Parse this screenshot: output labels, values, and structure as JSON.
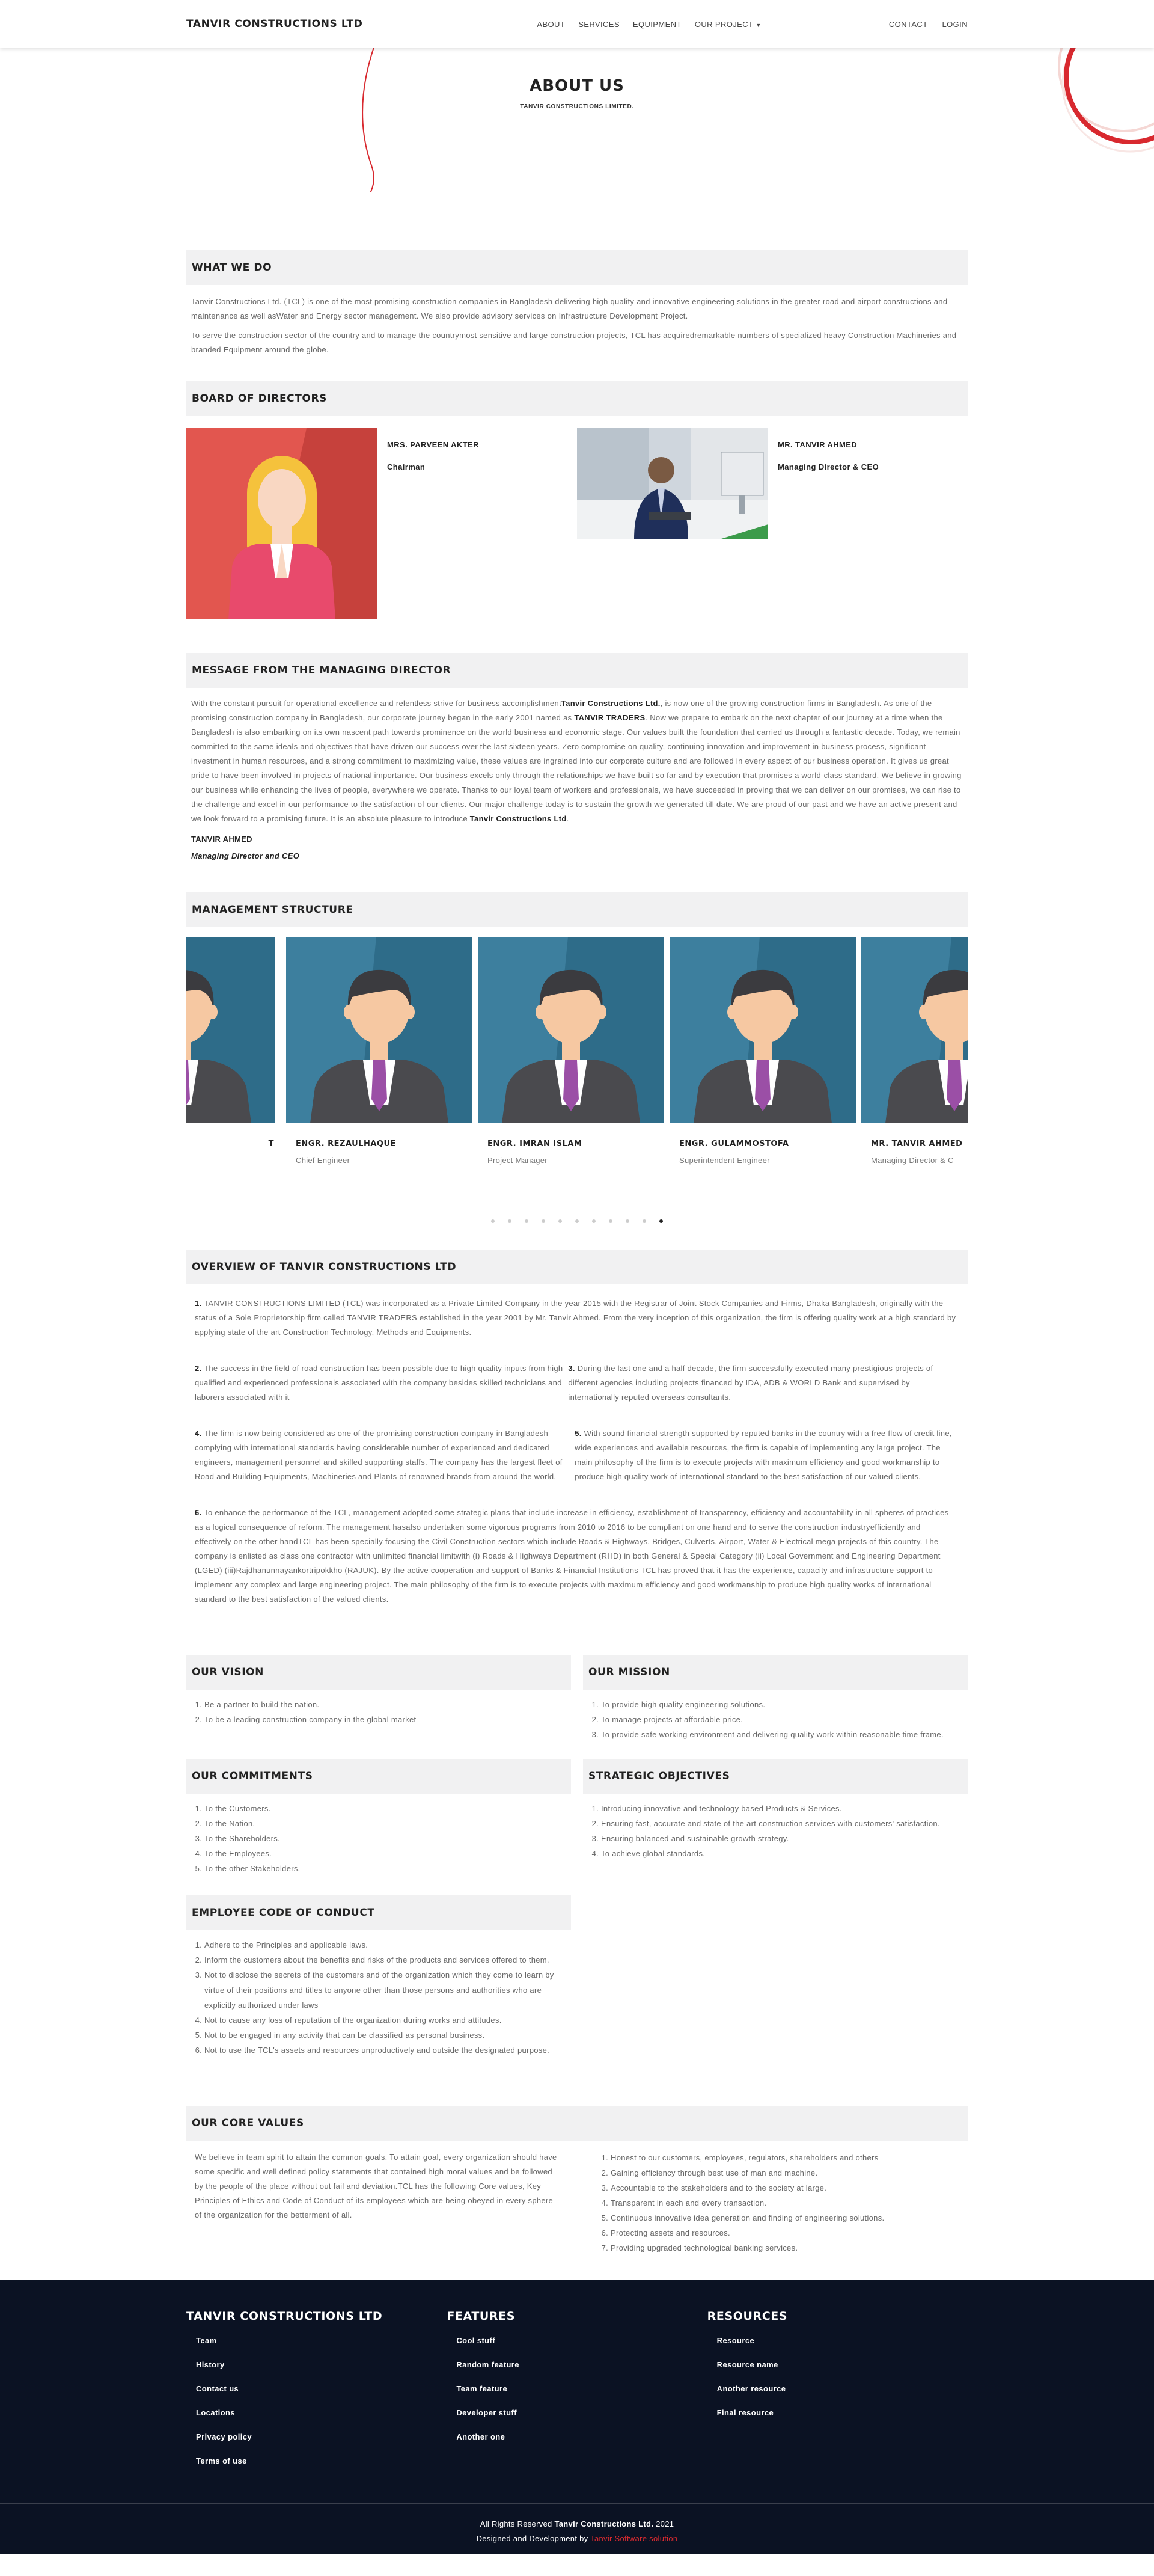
{
  "nav": {
    "brand": "TANVIR CONSTRUCTIONS LTD",
    "links": [
      "ABOUT",
      "SERVICES",
      "EQUIPMENT",
      "OUR PROJECT"
    ],
    "right": [
      "CONTACT",
      "LOGIN"
    ]
  },
  "hero": {
    "title": "ABOUT US",
    "subtitle": "TANVIR CONSTRUCTIONS LIMITED."
  },
  "what_we_do": {
    "heading": "WHAT WE DO",
    "p1": "Tanvir Constructions Ltd. (TCL) is one of the most promising construction companies in Bangladesh delivering high quality and innovative engineering solutions in the greater road and airport constructions and maintenance as well asWater and Energy sector management. We also provide advisory services on Infrastructure Development Project.",
    "p2": "To serve the construction sector of the country and to manage the countrymost sensitive and large construction projects, TCL has acquiredremarkable numbers of specialized heavy Construction Machineries and branded Equipment around the globe."
  },
  "board": {
    "heading": "BOARD OF DIRECTORS",
    "members": [
      {
        "name": "MRS. PARVEEN AKTER",
        "role": "Chairman"
      },
      {
        "name": "MR. TANVIR AHMED",
        "role": "Managing Director & CEO"
      }
    ]
  },
  "message": {
    "heading": "MESSAGE FROM THE MANAGING DIRECTOR",
    "a": "With the constant pursuit for operational excellence and relentless strive for business accomplishment",
    "b1": "Tanvir Constructions Ltd.",
    "c": ", is now one of the growing construction firms in Bangladesh. As one of the promising construction company in Bangladesh, our corporate journey began in the early 2001 named as",
    "b2": "TANVIR TRADERS",
    "d": ". Now we prepare to embark on the next chapter of our journey at a time when the Bangladesh is also embarking on its own nascent path towards prominence on the world business and economic stage. Our values built the foundation that carried us through a fantastic decade. Today, we remain committed to the same ideals and objectives that have driven our success over the last sixteen years. Zero compromise on quality, continuing innovation and improvement in business process, significant investment in human resources, and a strong commitment to maximizing value, these values are ingrained into our corporate culture and are followed in every aspect of our business operation. It gives us great pride to have been involved in projects of national importance. Our business excels only through the relationships we have built so far and by execution that promises a world-class standard. We believe in growing our business while enhancing the lives of people, everywhere we operate. Thanks to our loyal team of workers and professionals, we have succeeded in proving that we can deliver on our promises, we can rise to the challenge and excel in our performance to the satisfaction of our clients. Our major challenge today is to sustain the growth we generated till date. We are proud of our past and we have an active present and we look forward to a promising future. It is an absolute pleasure to introduce",
    "b3": "Tanvir Constructions Ltd",
    "e": ".",
    "sign_name": "TANVIR AHMED",
    "sign_role": "Managing Director and CEO"
  },
  "management": {
    "heading": "MANAGEMENT STRUCTURE",
    "partial_left_name": "T",
    "people": [
      {
        "name": "ENGR. REZAULHAQUE",
        "role": "Chief Engineer"
      },
      {
        "name": "ENGR. IMRAN ISLAM",
        "role": "Project Manager"
      },
      {
        "name": "ENGR. GULAMMOSTOFA",
        "role": "Superintendent Engineer"
      },
      {
        "name": "MR. TANVIR AHMED",
        "role": "Managing Director & C"
      }
    ],
    "dots": 11,
    "active_dot": 10
  },
  "overview": {
    "heading": "OVERVIEW OF TANVIR CONSTRUCTIONS LTD",
    "n1": "1.",
    "t1": "TANVIR CONSTRUCTIONS LIMITED (TCL) was incorporated as a Private Limited Company in the year 2015 with the Registrar of Joint Stock Companies and Firms, Dhaka Bangladesh, originally with the status of a Sole Proprietorship firm called TANVIR TRADERS established in the year 2001 by Mr. Tanvir Ahmed. From the very inception of this organization, the firm is offering quality work at a high standard by applying state of the art Construction Technology, Methods and Equipments.",
    "n2": "2.",
    "t2": "The success in the field of road construction has been possible due to high quality inputs from high qualified and experienced professionals associated with the company besides skilled technicians and laborers associated with it",
    "n3": "3.",
    "t3": "During the last one and a half decade, the firm successfully executed many prestigious projects of different agencies including projects financed by IDA, ADB & WORLD Bank and supervised by internationally reputed overseas consultants.",
    "n4": "4.",
    "t4": "The firm is now being considered as one of the promising construction company in Bangladesh complying with international standards having considerable number of experienced and dedicated engineers, management personnel and skilled supporting staffs. The company has the largest fleet of Road and Building Equipments, Machineries and Plants of renowned brands from around the world.",
    "n5": "5.",
    "t5": "With sound financial strength supported by reputed banks in the country with a free flow of credit line, wide experiences and available resources, the firm is capable of implementing any large project. The main philosophy of the firm is to execute projects with maximum efficiency and good workmanship to produce high quality work of international standard to the best satisfaction of our valued clients.",
    "n6": "6.",
    "t6": "To enhance the performance of the TCL, management adopted some strategic plans that include increase in efficiency, establishment of transparency, efficiency and accountability in all spheres of practices as a logical consequence of reform. The management hasalso undertaken some vigorous programs from 2010 to 2016 to be compliant on one hand and to serve the construction industryefficiently and effectively on the other handTCL has been specially focusing the Civil Construction sectors which include Roads & Highways, Bridges, Culverts, Airport, Water & Electrical mega projects of this country. The company is enlisted as class one contractor with unlimited financial limitwith (i) Roads & Highways Department (RHD) in both General & Special Category (ii) Local Government and Engineering Department (LGED) (iii)Rajdhanunnayankortripokkho (RAJUK). By the active cooperation and support of Banks & Financial Institutions TCL has proved that it has the experience, capacity and infrastructure support to implement any complex and large engineering project. The main philosophy of the firm is to execute projects with maximum efficiency and good workmanship to produce high quality works of international standard to the best satisfaction of the valued clients."
  },
  "vision": {
    "heading": "OUR VISION",
    "items": [
      "Be a partner to build the nation.",
      "To be a leading construction company in the global market"
    ]
  },
  "mission": {
    "heading": "OUR MISSION",
    "items": [
      "To provide high quality engineering solutions.",
      "To manage projects at affordable price.",
      "To provide safe working environment and delivering quality work within reasonable time frame."
    ]
  },
  "commitments": {
    "heading": "OUR COMMITMENTS",
    "items": [
      "To the Customers.",
      "To the Nation.",
      "To the Shareholders.",
      "To the Employees.",
      "To the other Stakeholders."
    ]
  },
  "strategic": {
    "heading": "STRATEGIC OBJECTIVES",
    "items": [
      "Introducing innovative and technology based Products & Services.",
      "Ensuring fast, accurate and state of the art construction services with customers' satisfaction.",
      "Ensuring balanced and sustainable growth strategy.",
      "To achieve global standards."
    ]
  },
  "conduct": {
    "heading": "EMPLOYEE CODE OF CONDUCT",
    "items": [
      "Adhere to the Principles and applicable laws.",
      "Inform the customers about the benefits and risks of the products and services offered to them.",
      "Not to disclose the secrets of the customers and of the organization which they come to learn by virtue of their positions and titles to anyone other than those persons and authorities who are explicitly authorized under laws",
      "Not to cause any loss of reputation of the organization during works and attitudes.",
      "Not to be engaged in any activity that can be classified as personal business.",
      "Not to use the TCL's assets and resources unproductively and outside the designated purpose."
    ]
  },
  "core": {
    "heading": "OUR CORE VALUES",
    "text": "We believe in team spirit to attain the common goals. To attain goal, every organization should have some specific and well defined policy statements that contained high moral values and be followed by the people of the place without out fail and deviation.TCL has the following Core values, Key Principles of Ethics and Code of Conduct of its employees which are being obeyed in every sphere of the organization for the betterment of all.",
    "items": [
      "Honest to our customers, employees, regulators, shareholders and others",
      "Gaining efficiency through best use of man and machine.",
      "Accountable to the stakeholders and to the society at large.",
      "Transparent in each and every transaction.",
      "Continuous innovative idea generation and finding of engineering solutions.",
      "Protecting assets and resources.",
      "Providing upgraded technological banking services."
    ]
  },
  "footer": {
    "col1": {
      "title": "TANVIR CONSTRUCTIONS LTD",
      "links": [
        "Team",
        "History",
        "Contact us",
        "Locations",
        "Privacy policy",
        "Terms of use"
      ]
    },
    "col2": {
      "title": "FEATURES",
      "links": [
        "Cool stuff",
        "Random feature",
        "Team feature",
        "Developer stuff",
        "Another one"
      ]
    },
    "col3": {
      "title": "RESOURCES",
      "links": [
        "Resource",
        "Resource name",
        "Another resource",
        "Final resource"
      ]
    },
    "rights_a": "All Rights Reserved",
    "rights_b": "Tanvir Constructions Ltd.",
    "rights_c": "2021",
    "dev_a": "Designed and Development by",
    "dev_b": "Tanvir Software solution"
  },
  "colors": {
    "accent": "#d8292f",
    "footer_bg": "#0b1223",
    "section_bg": "#f1f1f2",
    "avatar_bg": "#3d7f9e"
  }
}
